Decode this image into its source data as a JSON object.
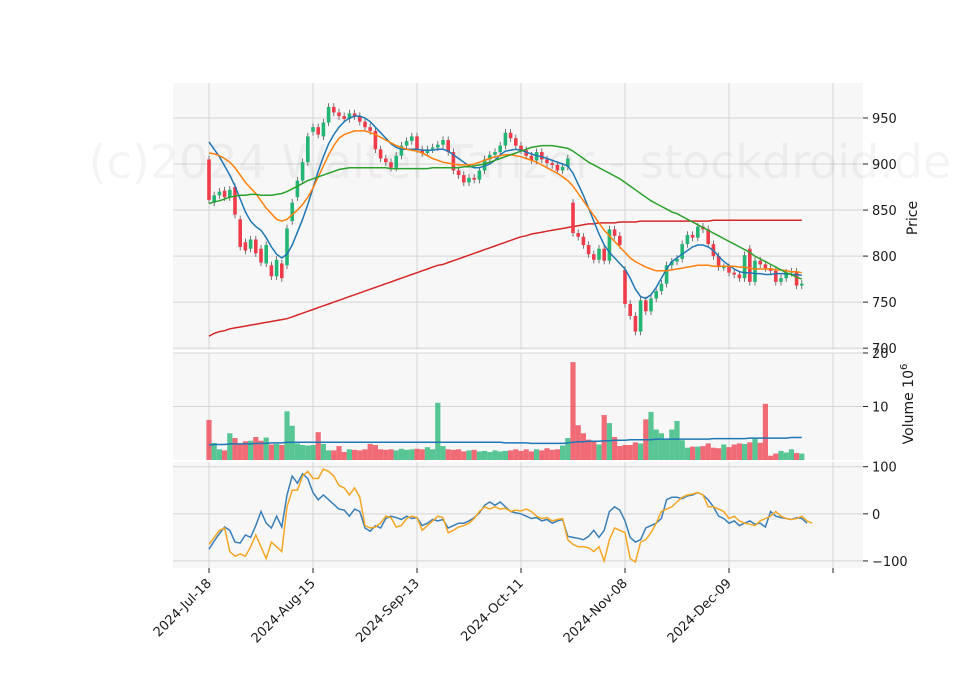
{
  "watermark": "(c)2024 Walter Tanzer - stockdroid.de",
  "colors": {
    "panel_bg": "#f7f7f7",
    "grid": "#d6d6d6",
    "up": "#22b573",
    "down": "#ee3c4b",
    "ma_short": "#1f77b4",
    "ma_mid": "#ff7f0e",
    "ma_long": "#2ca02c",
    "ma_200": "#d62728",
    "vol_avg": "#1f77b4",
    "osc_1": "#3a7fb8",
    "osc_2": "#f5a623"
  },
  "chart_data": {
    "type": "candlestick",
    "price_axis": {
      "label": "Price",
      "ticks": [
        700,
        750,
        800,
        850,
        900,
        950
      ],
      "ylim": [
        698,
        988
      ]
    },
    "volume_axis": {
      "label": "Volume  10",
      "label_exp": "6",
      "ticks": [
        10,
        20
      ],
      "ylim": [
        0,
        20
      ]
    },
    "oscillator_axis": {
      "ticks": [
        -100,
        0,
        100
      ],
      "ylim": [
        -115,
        110
      ]
    },
    "x_tick_labels": [
      "2024-Jul-18",
      "2024-Aug-15",
      "2024-Sep-13",
      "2024-Oct-11",
      "2024-Nov-08",
      "2024-Dec-09"
    ],
    "x_tick_index": [
      0,
      20,
      40,
      60,
      80,
      100
    ],
    "close": [
      861,
      866,
      870,
      864,
      872,
      845,
      810,
      806,
      818,
      803,
      793,
      812,
      778,
      796,
      776,
      830,
      858,
      882,
      902,
      930,
      940,
      932,
      945,
      962,
      956,
      952,
      949,
      955,
      952,
      946,
      940,
      936,
      916,
      906,
      902,
      896,
      909,
      920,
      925,
      930,
      916,
      912,
      916,
      918,
      921,
      926,
      913,
      893,
      888,
      880,
      885,
      883,
      893,
      905,
      910,
      913,
      920,
      934,
      928,
      920,
      915,
      909,
      904,
      913,
      905,
      901,
      899,
      893,
      897,
      906,
      825,
      821,
      812,
      802,
      796,
      808,
      795,
      829,
      822,
      812,
      748,
      735,
      718,
      752,
      740,
      754,
      762,
      770,
      790,
      794,
      797,
      813,
      823,
      820,
      832,
      829,
      813,
      800,
      788,
      788,
      782,
      780,
      776,
      801,
      772,
      795,
      791,
      787,
      784,
      772,
      776,
      782,
      783,
      768,
      770
    ],
    "open": [
      905,
      858,
      866,
      871,
      864,
      875,
      840,
      815,
      808,
      818,
      808,
      792,
      790,
      778,
      792,
      790,
      838,
      864,
      882,
      902,
      935,
      940,
      930,
      945,
      962,
      956,
      952,
      949,
      955,
      952,
      946,
      940,
      936,
      916,
      906,
      902,
      896,
      909,
      920,
      925,
      930,
      916,
      912,
      916,
      918,
      921,
      926,
      913,
      893,
      888,
      880,
      885,
      883,
      893,
      905,
      910,
      913,
      920,
      934,
      928,
      920,
      915,
      909,
      904,
      913,
      905,
      901,
      899,
      893,
      897,
      858,
      825,
      821,
      812,
      802,
      796,
      808,
      795,
      829,
      822,
      785,
      748,
      735,
      718,
      752,
      740,
      754,
      762,
      770,
      790,
      794,
      797,
      813,
      823,
      820,
      832,
      829,
      813,
      800,
      788,
      788,
      782,
      780,
      776,
      808,
      772,
      795,
      791,
      787,
      784,
      772,
      776,
      782,
      783,
      768
    ],
    "volume": [
      7.5,
      3.2,
      2.0,
      1.8,
      5.0,
      4.1,
      3.0,
      3.5,
      3.6,
      4.3,
      3.6,
      4.2,
      2.9,
      3.0,
      2.8,
      9.1,
      6.4,
      3.1,
      2.8,
      2.7,
      2.8,
      5.2,
      3.0,
      1.8,
      1.8,
      2.6,
      1.5,
      2.0,
      1.9,
      1.8,
      2.0,
      3.0,
      2.8,
      2.0,
      1.9,
      2.0,
      1.8,
      2.1,
      1.9,
      2.0,
      2.1,
      2.0,
      2.4,
      2.0,
      10.7,
      2.6,
      2.0,
      1.9,
      2.0,
      1.6,
      1.8,
      1.9,
      1.6,
      1.7,
      1.5,
      1.8,
      1.6,
      1.7,
      1.8,
      2.0,
      1.7,
      2.0,
      1.6,
      2.0,
      1.8,
      2.2,
      1.9,
      2.0,
      2.7,
      4.1,
      18.3,
      6.5,
      5.0,
      3.8,
      3.6,
      2.9,
      8.4,
      6.9,
      4.3,
      2.6,
      2.8,
      2.8,
      3.3,
      3.1,
      7.6,
      9.0,
      5.7,
      5.0,
      3.8,
      5.7,
      7.3,
      3.7,
      2.3,
      2.5,
      2.5,
      2.6,
      3.1,
      2.3,
      2.2,
      2.9,
      2.4,
      2.9,
      3.1,
      3.0,
      3.3,
      4.0,
      3.2,
      10.5,
      0.8,
      1.2,
      1.7,
      1.4,
      2.0,
      1.3,
      1.2
    ],
    "series": [
      {
        "kind": "ma",
        "color_key": "ma_short",
        "values": [
          924,
          916,
          908,
          898,
          888,
          876,
          862,
          848,
          838,
          832,
          828,
          820,
          810,
          802,
          798,
          802,
          812,
          826,
          840,
          856,
          874,
          892,
          908,
          922,
          932,
          940,
          946,
          950,
          952,
          952,
          950,
          946,
          940,
          934,
          928,
          922,
          918,
          916,
          916,
          916,
          916,
          915,
          915,
          915,
          916,
          916,
          914,
          910,
          906,
          902,
          898,
          896,
          896,
          898,
          900,
          904,
          910,
          914,
          915,
          916,
          915,
          913,
          911,
          909,
          908,
          906,
          904,
          902,
          900,
          898,
          890,
          878,
          866,
          852,
          838,
          824,
          812,
          804,
          798,
          792,
          786,
          776,
          764,
          756,
          754,
          758,
          766,
          776,
          786,
          794,
          798,
          802,
          806,
          810,
          812,
          812,
          810,
          806,
          800,
          794,
          790,
          786,
          783,
          782,
          782,
          781,
          781,
          780,
          780,
          781,
          781,
          781,
          780,
          780,
          779
        ]
      },
      {
        "kind": "ma",
        "color_key": "ma_mid",
        "values": [
          912,
          911,
          909,
          906,
          902,
          896,
          888,
          880,
          874,
          868,
          860,
          852,
          846,
          840,
          838,
          840,
          845,
          850,
          856,
          864,
          874,
          886,
          898,
          910,
          920,
          928,
          932,
          934,
          936,
          936,
          936,
          934,
          932,
          929,
          926,
          923,
          920,
          918,
          916,
          915,
          914,
          912,
          909,
          906,
          904,
          902,
          901,
          900,
          899,
          899,
          899,
          900,
          902,
          904,
          906,
          908,
          909,
          910,
          910,
          909,
          908,
          906,
          904,
          902,
          899,
          896,
          893,
          890,
          886,
          882,
          876,
          868,
          860,
          852,
          844,
          836,
          828,
          822,
          816,
          810,
          804,
          798,
          794,
          791,
          788,
          786,
          784,
          784,
          784,
          785,
          786,
          787,
          788,
          789,
          790,
          790,
          790,
          789,
          789,
          789,
          789,
          789,
          788,
          788,
          787,
          786,
          786,
          786,
          786,
          785,
          785,
          784,
          783,
          783,
          782
        ]
      },
      {
        "kind": "ma",
        "color_key": "ma_long",
        "values": [
          857,
          859,
          860,
          862,
          864,
          865,
          866,
          866,
          867,
          867,
          866,
          866,
          866,
          867,
          868,
          870,
          873,
          876,
          879,
          882,
          884,
          886,
          888,
          890,
          892,
          894,
          895,
          896,
          896,
          896,
          896,
          896,
          896,
          896,
          896,
          895,
          895,
          895,
          895,
          895,
          895,
          895,
          895,
          896,
          896,
          896,
          896,
          896,
          896,
          897,
          897,
          898,
          899,
          900,
          902,
          904,
          906,
          908,
          910,
          912,
          914,
          916,
          918,
          919,
          920,
          920,
          920,
          919,
          918,
          917,
          914,
          910,
          906,
          902,
          899,
          896,
          893,
          890,
          887,
          884,
          880,
          876,
          872,
          868,
          864,
          860,
          857,
          854,
          851,
          848,
          846,
          843,
          840,
          837,
          834,
          831,
          828,
          825,
          822,
          819,
          816,
          813,
          810,
          807,
          804,
          800,
          797,
          794,
          791,
          788,
          785,
          782,
          780,
          777,
          775
        ]
      },
      {
        "kind": "ma",
        "color_key": "ma_200",
        "values": [
          713,
          716,
          718,
          719,
          721,
          722,
          723,
          724,
          725,
          726,
          727,
          728,
          729,
          730,
          731,
          732,
          734,
          736,
          738,
          740,
          742,
          744,
          746,
          748,
          750,
          752,
          754,
          756,
          758,
          760,
          762,
          764,
          766,
          768,
          770,
          772,
          774,
          776,
          778,
          780,
          782,
          784,
          786,
          788,
          790,
          791,
          793,
          795,
          797,
          799,
          801,
          803,
          805,
          807,
          809,
          811,
          813,
          815,
          817,
          819,
          821,
          822,
          824,
          825,
          826,
          827,
          828,
          829,
          830,
          831,
          832,
          833,
          834,
          835,
          835,
          836,
          836,
          836,
          836,
          837,
          837,
          837,
          837,
          838,
          838,
          838,
          838,
          838,
          838,
          838,
          838,
          838,
          838,
          838,
          838,
          838,
          838,
          839,
          839,
          839,
          839,
          839,
          839,
          839,
          839,
          839,
          839,
          839,
          839,
          839,
          839,
          839,
          839,
          839,
          839
        ]
      },
      {
        "kind": "volume_avg",
        "color_key": "vol_avg",
        "values": [
          2.8,
          2.9,
          2.9,
          2.9,
          3.0,
          3.0,
          3.0,
          3.0,
          3.0,
          3.1,
          3.1,
          3.1,
          3.2,
          3.2,
          3.2,
          3.3,
          3.3,
          3.3,
          3.3,
          3.3,
          3.3,
          3.3,
          3.3,
          3.3,
          3.3,
          3.3,
          3.3,
          3.3,
          3.3,
          3.3,
          3.3,
          3.3,
          3.3,
          3.3,
          3.3,
          3.3,
          3.3,
          3.3,
          3.3,
          3.3,
          3.3,
          3.3,
          3.3,
          3.3,
          3.3,
          3.3,
          3.3,
          3.3,
          3.3,
          3.3,
          3.3,
          3.3,
          3.3,
          3.3,
          3.3,
          3.3,
          3.3,
          3.2,
          3.2,
          3.2,
          3.2,
          3.2,
          3.1,
          3.1,
          3.1,
          3.1,
          3.1,
          3.1,
          3.1,
          3.2,
          3.3,
          3.4,
          3.4,
          3.5,
          3.5,
          3.5,
          3.6,
          3.6,
          3.7,
          3.7,
          3.7,
          3.8,
          3.8,
          3.8,
          3.8,
          3.8,
          3.9,
          3.9,
          3.9,
          3.9,
          3.9,
          3.9,
          3.9,
          3.9,
          3.9,
          3.9,
          3.9,
          4.0,
          4.0,
          4.0,
          4.0,
          4.0,
          4.0,
          4.0,
          4.1,
          4.1,
          4.1,
          4.1,
          4.1,
          4.1,
          4.1,
          4.1,
          4.2,
          4.2,
          4.2
        ]
      },
      {
        "kind": "oscillator",
        "color_key": "osc_1",
        "values": [
          -75,
          -58,
          -42,
          -28,
          -35,
          -60,
          -62,
          -45,
          -50,
          -25,
          5,
          -20,
          -30,
          -5,
          -28,
          40,
          80,
          65,
          85,
          75,
          45,
          30,
          40,
          30,
          20,
          10,
          8,
          -5,
          10,
          5,
          -30,
          -37,
          -25,
          -30,
          -10,
          -5,
          -8,
          -12,
          -5,
          -10,
          -8,
          -25,
          -20,
          -12,
          -15,
          -12,
          -30,
          -25,
          -20,
          -20,
          -15,
          -8,
          2,
          18,
          25,
          18,
          25,
          15,
          5,
          2,
          0,
          -5,
          -10,
          -8,
          -15,
          -12,
          -20,
          -15,
          -12,
          -48,
          -50,
          -52,
          -55,
          -48,
          -35,
          -50,
          -35,
          5,
          15,
          8,
          -15,
          -50,
          -60,
          -55,
          -30,
          -25,
          -20,
          -10,
          30,
          35,
          35,
          32,
          38,
          40,
          45,
          40,
          30,
          15,
          -5,
          -10,
          -20,
          -15,
          -25,
          -20,
          -15,
          -22,
          -20,
          -28,
          5,
          -5,
          -8,
          -10,
          -12,
          -8,
          -10,
          -20
        ]
      },
      {
        "kind": "oscillator",
        "color_key": "osc_2",
        "values": [
          -65,
          -50,
          -35,
          -30,
          -80,
          -90,
          -85,
          -90,
          -70,
          -45,
          -70,
          -95,
          -60,
          -70,
          -80,
          15,
          50,
          50,
          80,
          90,
          75,
          75,
          95,
          90,
          80,
          60,
          55,
          40,
          55,
          35,
          -25,
          -30,
          -28,
          -20,
          -5,
          -8,
          -28,
          -25,
          -10,
          -5,
          -8,
          -35,
          -25,
          -15,
          -5,
          -8,
          -40,
          -35,
          -28,
          -25,
          -20,
          -10,
          5,
          15,
          10,
          15,
          10,
          12,
          5,
          8,
          6,
          10,
          5,
          -5,
          -10,
          -8,
          -15,
          -12,
          -10,
          -55,
          -65,
          -70,
          -70,
          -72,
          -80,
          -70,
          -100,
          -55,
          -30,
          -35,
          -40,
          -95,
          -102,
          -60,
          -55,
          -40,
          -20,
          5,
          10,
          15,
          25,
          35,
          40,
          42,
          45,
          40,
          15,
          15,
          10,
          5,
          -10,
          -5,
          -15,
          -20,
          -22,
          -25,
          -15,
          -10,
          -5,
          5,
          -5,
          -10,
          -12,
          -10,
          -5,
          -15,
          -20
        ]
      }
    ]
  }
}
